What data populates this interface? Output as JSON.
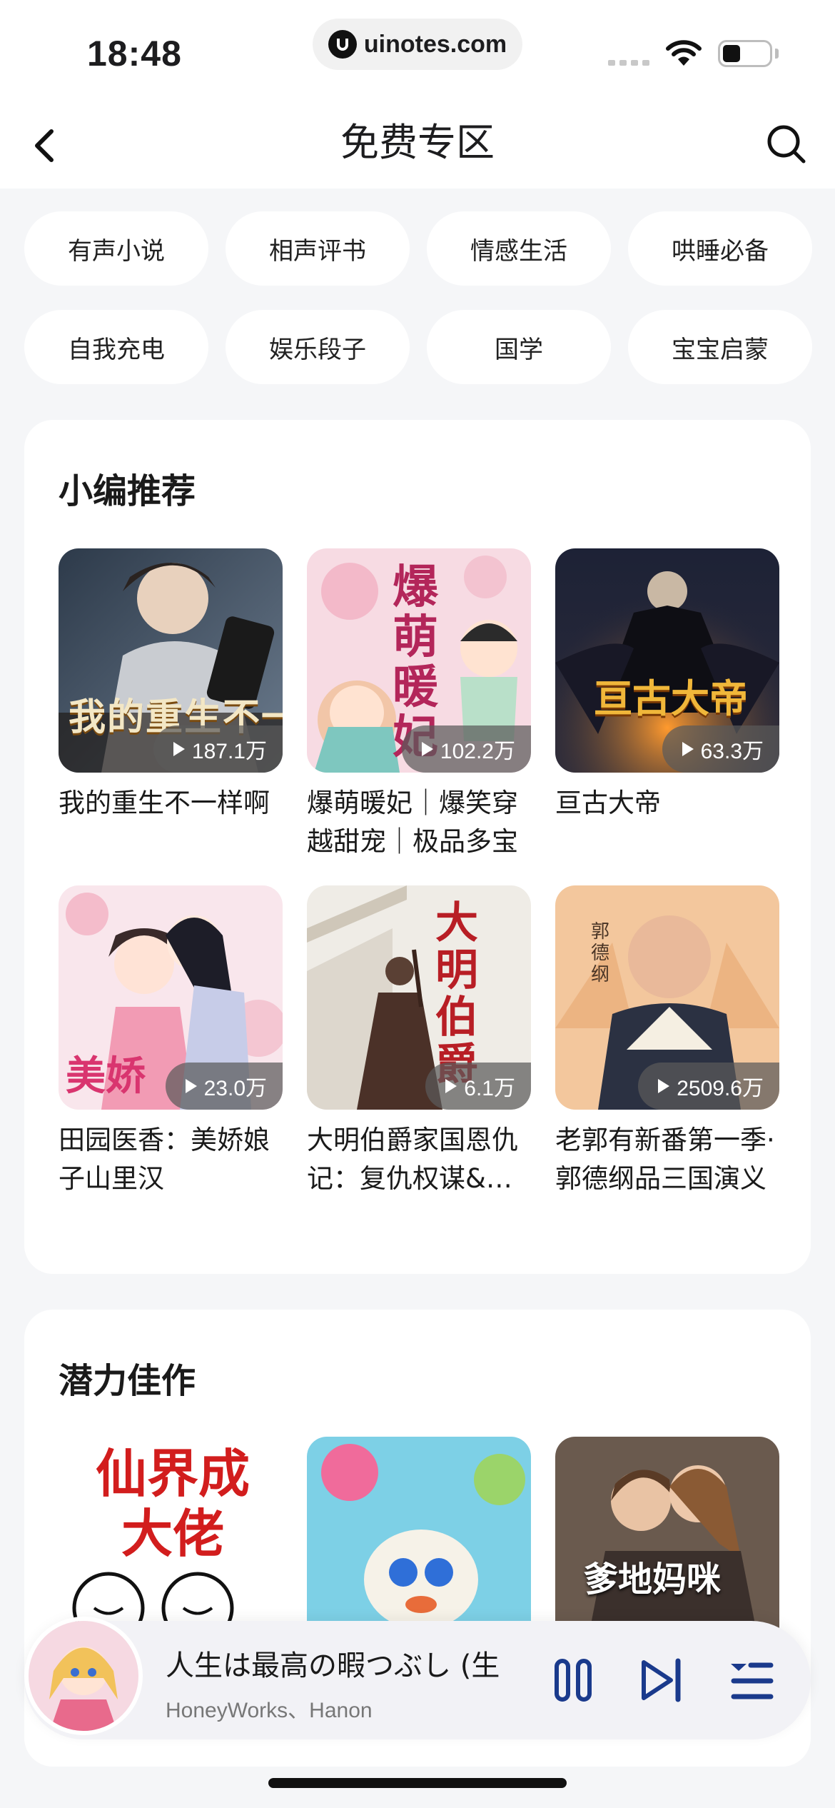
{
  "status": {
    "time": "18:48",
    "url": "uinotes.com"
  },
  "header": {
    "title": "免费专区"
  },
  "categories": [
    "有声小说",
    "相声评书",
    "情感生活",
    "哄睡必备",
    "自我充电",
    "娱乐段子",
    "国学",
    "宝宝启蒙"
  ],
  "section1": {
    "title": "小编推荐",
    "items": [
      {
        "title": "我的重生不一样啊",
        "plays": "187.1万",
        "cover_text": "我的重生不一"
      },
      {
        "title": "爆萌暖妃｜爆笑穿越甜宠｜极品多宝",
        "plays": "102.2万",
        "cover_text": "爆萌暖妃"
      },
      {
        "title": "亘古大帝",
        "plays": "63.3万",
        "cover_text": "亘古大帝"
      },
      {
        "title": "田园医香：美娇娘子山里汉",
        "plays": "23.0万",
        "cover_text": "美娇"
      },
      {
        "title": "大明伯爵家国恩仇记：复仇权谋&宫斗",
        "plays": "6.1万",
        "cover_text": "大明伯爵"
      },
      {
        "title": "老郭有新番第一季·郭德纲品三国演义",
        "plays": "2509.6万",
        "cover_text": "郭德纲"
      }
    ]
  },
  "section2": {
    "title": "潜力佳作",
    "items": [
      {
        "cover_text": "仙界成大佬"
      },
      {
        "cover_text": ""
      },
      {
        "cover_text": "爹地妈咪"
      }
    ]
  },
  "player": {
    "song": "人生は最高の暇つぶし (生",
    "artist": "HoneyWorks、Hanon"
  },
  "colors": {
    "background": "#f5f6f8",
    "card": "#ffffff",
    "accent": "#1a3a8c"
  }
}
